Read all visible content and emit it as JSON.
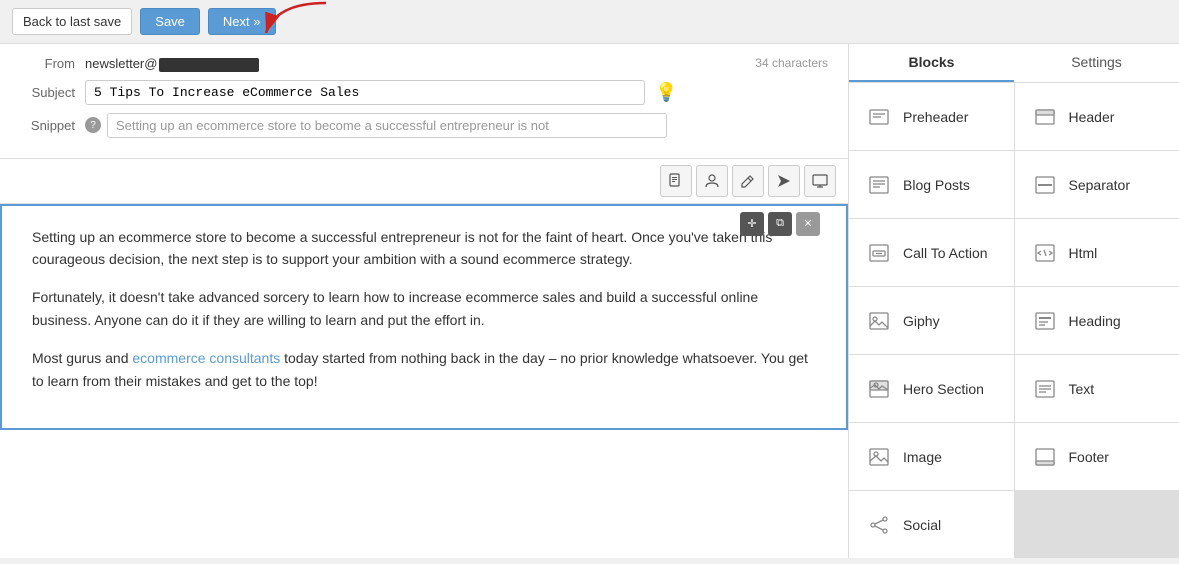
{
  "topBar": {
    "back_label": "Back to last save",
    "save_label": "Save",
    "next_label": "Next »"
  },
  "emailMeta": {
    "from_label": "From",
    "from_value": "newsletter@",
    "char_count": "34 characters",
    "subject_label": "Subject",
    "subject_value": "5 Tips To Increase eCommerce Sales",
    "snippet_label": "Snippet",
    "snippet_value": "Setting up an ecommerce store to become a successful entrepreneur is not"
  },
  "toolbar": {
    "buttons": [
      {
        "id": "tb-document",
        "icon": "📄"
      },
      {
        "id": "tb-user",
        "icon": "👤"
      },
      {
        "id": "tb-pen",
        "icon": "✏️"
      },
      {
        "id": "tb-send",
        "icon": "➤"
      },
      {
        "id": "tb-desktop",
        "icon": "🖥️"
      }
    ]
  },
  "editorContent": {
    "paragraphs": [
      "Setting up an ecommerce store to become a successful entrepreneur is not for the faint of heart. Once you've taken this courageous decision, the next step is to support your ambition with a sound ecommerce strategy.",
      "Fortunately, it doesn't take advanced sorcery to learn how to increase ecommerce sales and build a successful online business. Anyone can do it if they are willing to learn and put the effort in.",
      "Most gurus and ecommerce consultants today started from nothing back in the day – no prior knowledge whatsoever. You get to learn from their mistakes and get to the top!"
    ],
    "link_text": "ecommerce consultants"
  },
  "rightPanel": {
    "tabs": [
      {
        "id": "blocks",
        "label": "Blocks",
        "active": true
      },
      {
        "id": "settings",
        "label": "Settings",
        "active": false
      }
    ],
    "blocks": [
      {
        "id": "preheader",
        "label": "Preheader",
        "icon": "preheader"
      },
      {
        "id": "header",
        "label": "Header",
        "icon": "header"
      },
      {
        "id": "blog-posts",
        "label": "Blog Posts",
        "icon": "blog-posts"
      },
      {
        "id": "separator",
        "label": "Separator",
        "icon": "separator"
      },
      {
        "id": "call-to-action",
        "label": "Call To Action",
        "icon": "call-to-action"
      },
      {
        "id": "html",
        "label": "Html",
        "icon": "html"
      },
      {
        "id": "giphy",
        "label": "Giphy",
        "icon": "giphy"
      },
      {
        "id": "heading",
        "label": "Heading",
        "icon": "heading"
      },
      {
        "id": "hero-section",
        "label": "Hero Section",
        "icon": "hero-section"
      },
      {
        "id": "text",
        "label": "Text",
        "icon": "text"
      },
      {
        "id": "image",
        "label": "Image",
        "icon": "image"
      },
      {
        "id": "footer",
        "label": "Footer",
        "icon": "footer"
      },
      {
        "id": "social",
        "label": "Social",
        "icon": "social"
      }
    ]
  }
}
